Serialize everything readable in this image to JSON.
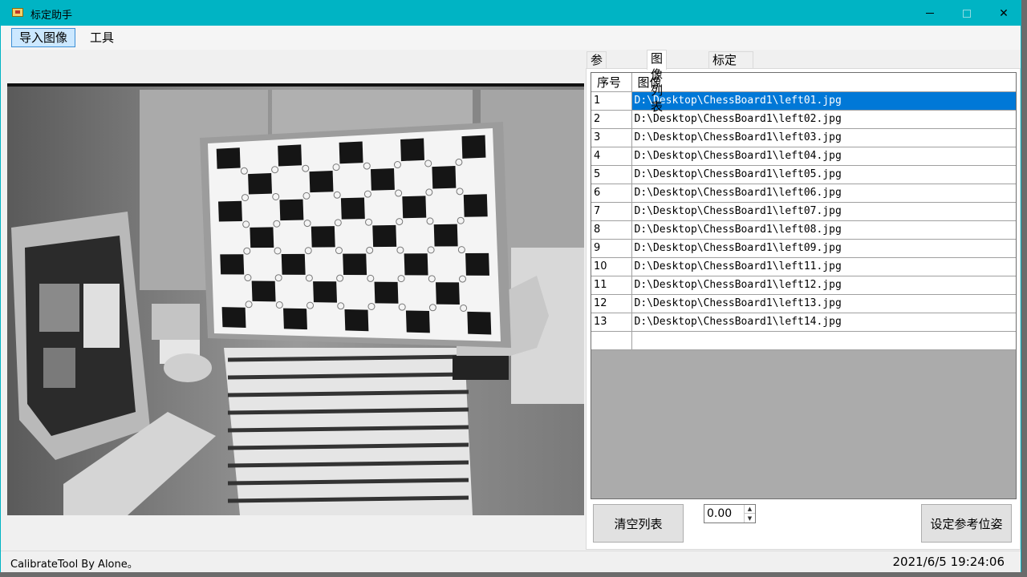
{
  "window": {
    "title": "标定助手"
  },
  "menu": {
    "items": [
      "导入图像",
      "工具"
    ]
  },
  "tabs": [
    "参数设置",
    "图像列表",
    "标定"
  ],
  "image_list": {
    "headers": [
      "序号",
      "图像"
    ],
    "rows": [
      {
        "idx": "1",
        "path": "D:\\Desktop\\ChessBoard1\\left01.jpg"
      },
      {
        "idx": "2",
        "path": "D:\\Desktop\\ChessBoard1\\left02.jpg"
      },
      {
        "idx": "3",
        "path": "D:\\Desktop\\ChessBoard1\\left03.jpg"
      },
      {
        "idx": "4",
        "path": "D:\\Desktop\\ChessBoard1\\left04.jpg"
      },
      {
        "idx": "5",
        "path": "D:\\Desktop\\ChessBoard1\\left05.jpg"
      },
      {
        "idx": "6",
        "path": "D:\\Desktop\\ChessBoard1\\left06.jpg"
      },
      {
        "idx": "7",
        "path": "D:\\Desktop\\ChessBoard1\\left07.jpg"
      },
      {
        "idx": "8",
        "path": "D:\\Desktop\\ChessBoard1\\left08.jpg"
      },
      {
        "idx": "9",
        "path": "D:\\Desktop\\ChessBoard1\\left09.jpg"
      },
      {
        "idx": "10",
        "path": "D:\\Desktop\\ChessBoard1\\left11.jpg"
      },
      {
        "idx": "11",
        "path": "D:\\Desktop\\ChessBoard1\\left12.jpg"
      },
      {
        "idx": "12",
        "path": "D:\\Desktop\\ChessBoard1\\left13.jpg"
      },
      {
        "idx": "13",
        "path": "D:\\Desktop\\ChessBoard1\\left14.jpg"
      }
    ]
  },
  "controls": {
    "clear_label": "清空列表",
    "spin_value": "0.00",
    "set_ref_label": "设定参考位姿"
  },
  "status": {
    "left": "CalibrateTool By Alone。",
    "right": "2021/6/5 19:24:06"
  },
  "colors": {
    "titlebar": "#00b4c4",
    "selection": "#0078d7"
  }
}
